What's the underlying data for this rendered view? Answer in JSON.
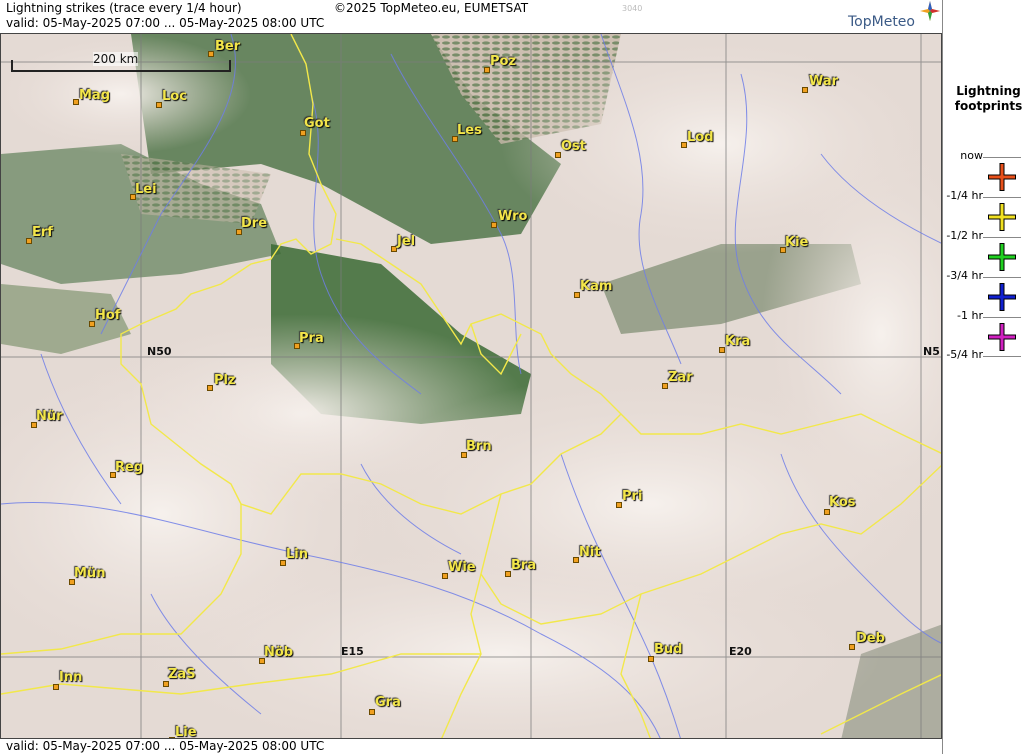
{
  "header": {
    "title": "Lightning strikes (trace every 1/4 hour)",
    "copyright": "©2025 TopMeteo.eu, EUMETSAT",
    "code": "3040",
    "validity": "valid:  05-May-2025 07:00 ... 05-May-2025 08:00 UTC",
    "logo_text": "TopMeteo"
  },
  "footer": {
    "validity": "valid:  05-May-2025 07:00 ... 05-May-2025 08:00 UTC"
  },
  "map": {
    "scale_label": "200 km",
    "coords": {
      "n50_left": "N50",
      "n50_right": "N5",
      "e15": "E15",
      "e20": "E20"
    },
    "cities": [
      "Ber",
      "Poz",
      "War",
      "Mag",
      "Loc",
      "Got",
      "Les",
      "Lod",
      "Ost",
      "Lei",
      "Erf",
      "Dre",
      "Wro",
      "Jel",
      "Kie",
      "Kam",
      "Hof",
      "Pra",
      "Kra",
      "Zar",
      "Plz",
      "Nür",
      "Brn",
      "Reg",
      "Pri",
      "Kos",
      "Lin",
      "Wie",
      "Bra",
      "Nit",
      "Mün",
      "Nöb",
      "E15",
      "Bud",
      "E20",
      "Deb",
      "Inn",
      "ZaS",
      "Gra",
      "Lie"
    ]
  },
  "legend": {
    "title_line1": "Lightning",
    "title_line2": "footprints",
    "items": [
      {
        "label": "now",
        "color": ""
      },
      {
        "label": "-1/4 hr",
        "color": "#e8501a"
      },
      {
        "label": "-1/2 hr",
        "color": "#f0e020"
      },
      {
        "label": "-3/4 hr",
        "color": "#20d020"
      },
      {
        "label": "-1 hr",
        "color": "#1020d0"
      },
      {
        "label": "-5/4 hr",
        "color": "#d020c0"
      }
    ]
  }
}
